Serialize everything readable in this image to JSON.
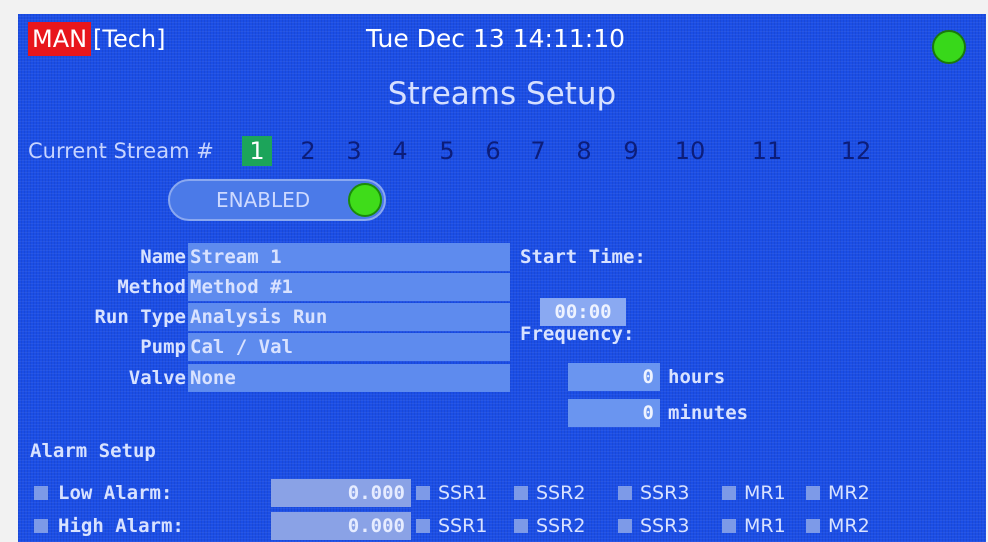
{
  "header": {
    "mode": "MAN",
    "user": "[Tech]",
    "datetime": "Tue Dec 13 14:11:10",
    "status_color": "#38d81a"
  },
  "page": {
    "title": "Streams Setup"
  },
  "streams": {
    "label": "Current Stream #",
    "numbers": [
      "1",
      "2",
      "3",
      "4",
      "5",
      "6",
      "7",
      "8",
      "9",
      "10",
      "11",
      "12"
    ],
    "current": "1"
  },
  "toggle": {
    "label": "ENABLED",
    "state": "on"
  },
  "fields": {
    "name": {
      "label": "Name",
      "value": "Stream 1"
    },
    "method": {
      "label": "Method",
      "value": "Method #1"
    },
    "run_type": {
      "label": "Run Type",
      "value": "Analysis Run"
    },
    "pump": {
      "label": "Pump",
      "value": "Cal / Val"
    },
    "valve": {
      "label": "Valve",
      "value": "None"
    }
  },
  "schedule": {
    "start_time_label": "Start Time:",
    "start_time": "00:00",
    "frequency_label": "Frequency:",
    "hours": "0",
    "hours_unit": "hours",
    "minutes": "0",
    "minutes_unit": "minutes"
  },
  "alarm": {
    "section_label": "Alarm Setup",
    "relays": [
      "SSR1",
      "SSR2",
      "SSR3",
      "MR1",
      "MR2"
    ],
    "low": {
      "label": "Low Alarm:",
      "value": "0.000"
    },
    "high": {
      "label": "High Alarm:",
      "value": "0.000"
    }
  }
}
